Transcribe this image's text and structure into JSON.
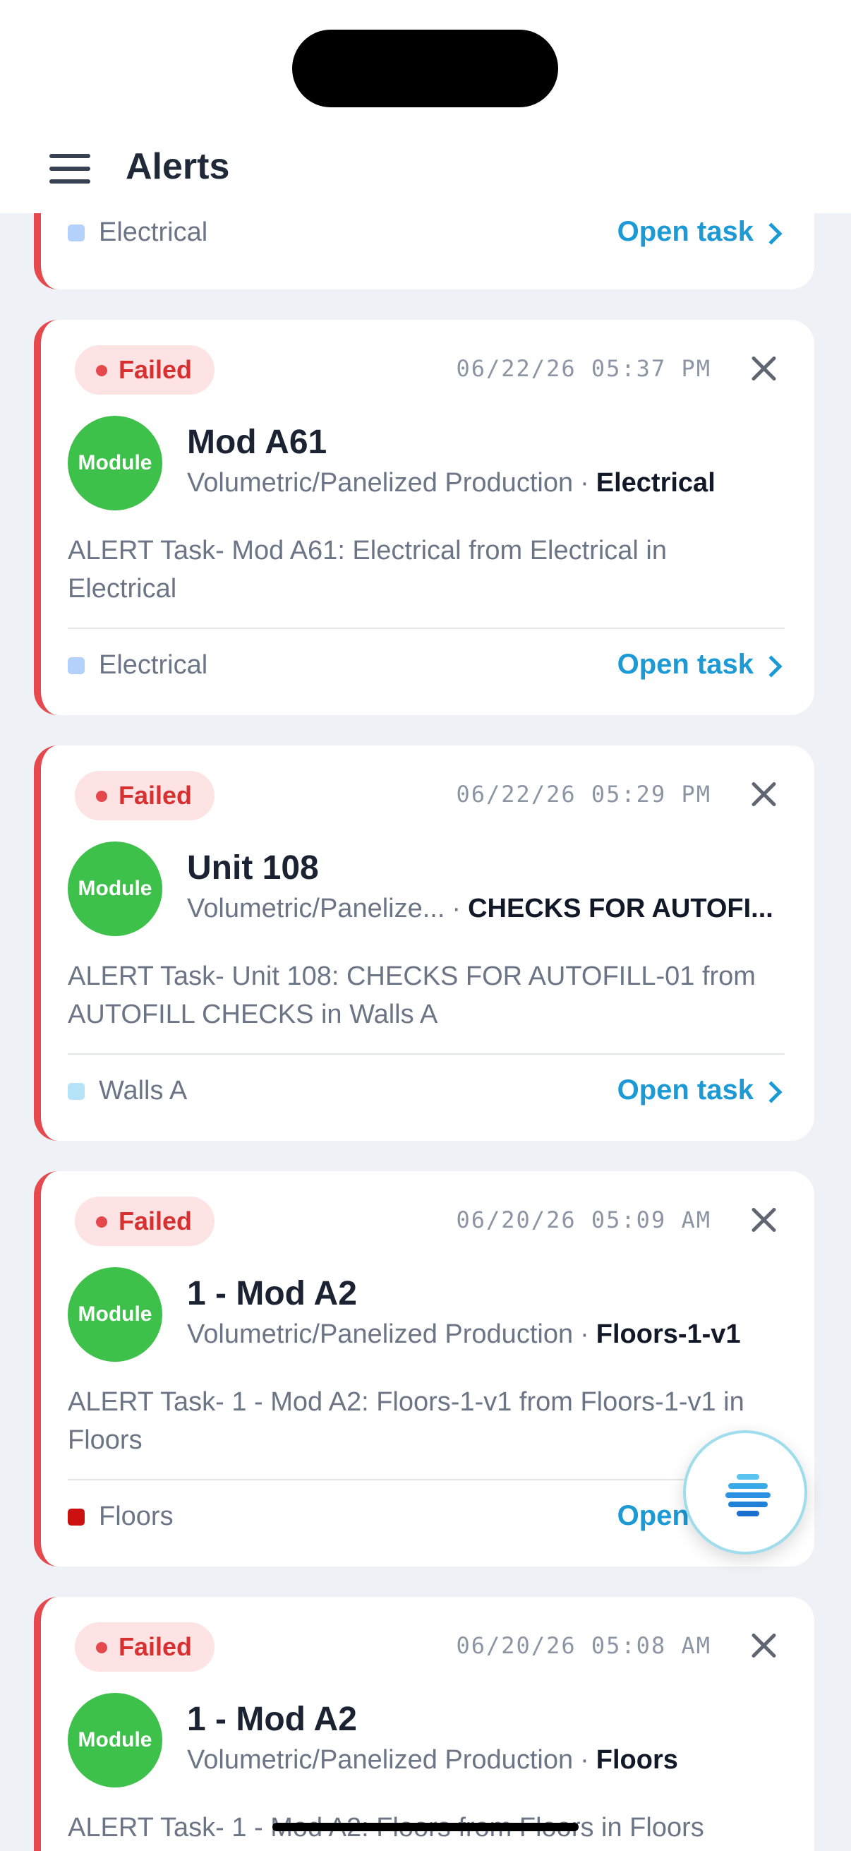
{
  "header": {
    "title": "Alerts"
  },
  "partial_card": {
    "location": "Electrical",
    "location_color": "#b3d1fb",
    "open_label": "Open task"
  },
  "alerts": [
    {
      "status": "Failed",
      "timestamp": "06/22/26 05:37 PM",
      "avatar": "Module",
      "title": "Mod A61",
      "workflow": "Volumetric/Panelized Production",
      "separator": "·",
      "step": "Electrical",
      "description": "ALERT Task- Mod A61: Electrical from Electrical in Electrical",
      "location": "Electrical",
      "location_color": "#b3d1fb",
      "open_label": "Open task"
    },
    {
      "status": "Failed",
      "timestamp": "06/22/26 05:29 PM",
      "avatar": "Module",
      "title": "Unit 108",
      "workflow": "Volumetric/Panelize...",
      "separator": "·",
      "step": "CHECKS FOR AUTOFI...",
      "description": "ALERT Task- Unit 108: CHECKS FOR AUTOFILL-01 from AUTOFILL CHECKS  in Walls A",
      "location": "Walls A",
      "location_color": "#b5e3f7",
      "open_label": "Open task"
    },
    {
      "status": "Failed",
      "timestamp": "06/20/26 05:09 AM",
      "avatar": "Module",
      "title": "1 - Mod A2",
      "workflow": "Volumetric/Panelized Production",
      "separator": "·",
      "step": "Floors-1-v1",
      "description": "ALERT Task- 1 - Mod A2: Floors-1-v1 from Floors-1-v1 in Floors",
      "location": "Floors",
      "location_color": "#cc1111",
      "open_label": "Open task"
    },
    {
      "status": "Failed",
      "timestamp": "06/20/26 05:08 AM",
      "avatar": "Module",
      "title": "1 - Mod A2",
      "workflow": "Volumetric/Panelized Production",
      "separator": "·",
      "step": "Floors",
      "description": "ALERT Task- 1 - Mod A2: Floors from Floors  in Floors",
      "location": "",
      "location_color": "",
      "open_label": ""
    }
  ],
  "fab": {
    "icon": "stacked-lines-icon"
  },
  "colors": {
    "accent": "#1c9ad6",
    "failed": "#e5484d",
    "module": "#3dc14a"
  }
}
